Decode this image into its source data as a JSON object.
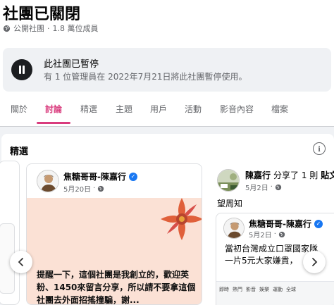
{
  "group": {
    "title": "社團已關閉",
    "privacy": "公開社團",
    "separator": "·",
    "members": "1.8 萬位成員"
  },
  "paused_notice": {
    "heading": "此社團已暫停",
    "detail": "有 1 位管理員在 2022年7月21日將此社團暫停使用。"
  },
  "tabs": [
    {
      "label": "關於"
    },
    {
      "label": "討論"
    },
    {
      "label": "精選"
    },
    {
      "label": "主題"
    },
    {
      "label": "用戶"
    },
    {
      "label": "活動"
    },
    {
      "label": "影音內容"
    },
    {
      "label": "檔案"
    }
  ],
  "featured": {
    "heading": "精選",
    "post1": {
      "author": "焦糖哥哥-陳嘉行",
      "date": "5月20日",
      "text": "提醒一下，這個社團是我創立的，歡迎英粉、1450來留言分享，所以請不要拿這個社團去外面招搖撞騙，謝..."
    },
    "post2": {
      "author": "陳嘉行",
      "action": "分享了 1 則",
      "object": "貼文",
      "date": "5月2日",
      "text": "望周知",
      "shared": {
        "author": "焦糖哥哥-陳嘉行",
        "date": "5月2日",
        "text_line1": "當初台灣成立口罩國家隊",
        "text_line2": "一片5元大家嫌貴，",
        "thumb_menu": [
          "即時",
          "熱門",
          "影音",
          "娛樂",
          "運動",
          "全球"
        ]
      }
    }
  },
  "colors": {
    "accent": "#d93b7d",
    "verified": "#1877f2",
    "post_bg": "#fbe1d5"
  }
}
